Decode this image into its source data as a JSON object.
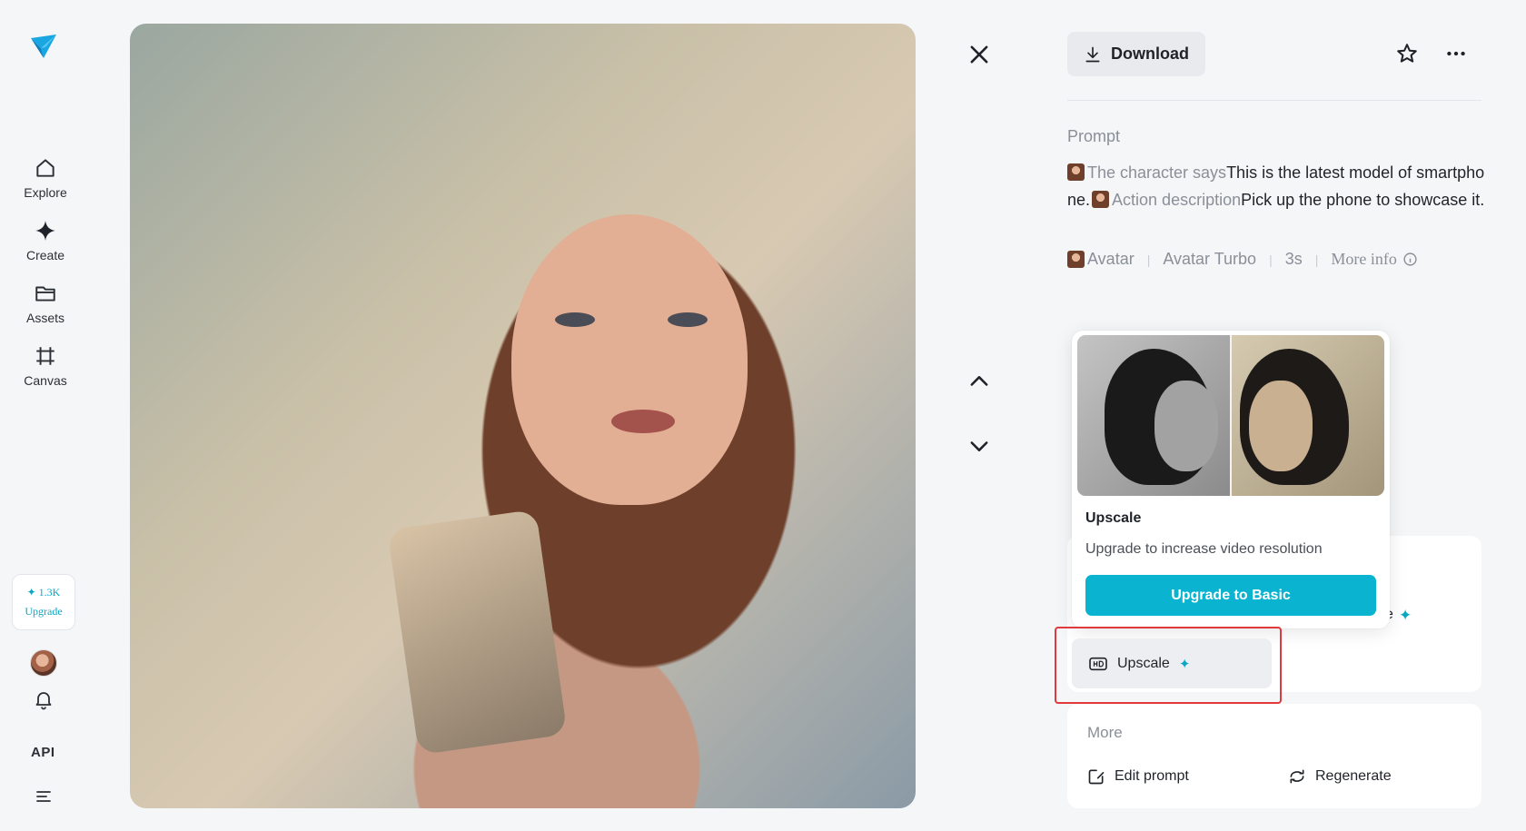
{
  "sidebar": {
    "items": [
      {
        "label": "Explore",
        "icon": "home-icon"
      },
      {
        "label": "Create",
        "icon": "diamond-icon"
      },
      {
        "label": "Assets",
        "icon": "folder-icon"
      },
      {
        "label": "Canvas",
        "icon": "crop-frame-icon"
      }
    ],
    "credits": "✦ 1.3K",
    "upgrade": "Upgrade",
    "api": "API"
  },
  "panel": {
    "download_label": "Download",
    "prompt_title": "Prompt",
    "prompt": {
      "tag1": "The character says",
      "text1": "This is the latest model of smartphone.",
      "tag2": "Action description",
      "text2": "Pick up the phone to showcase it."
    },
    "meta": {
      "model": "Avatar",
      "version": "Avatar Turbo",
      "duration": "3s",
      "more_info": "More info"
    },
    "popover": {
      "title": "Upscale",
      "description": "Upgrade to increase video resolution",
      "button": "Upgrade to Basic"
    },
    "upscale_label": "Upscale",
    "partial_peek": "e",
    "more": {
      "title": "More",
      "edit_prompt": "Edit prompt",
      "regenerate": "Regenerate"
    }
  },
  "colors": {
    "accent": "#0ab3cf",
    "highlight": "#e0393e"
  }
}
